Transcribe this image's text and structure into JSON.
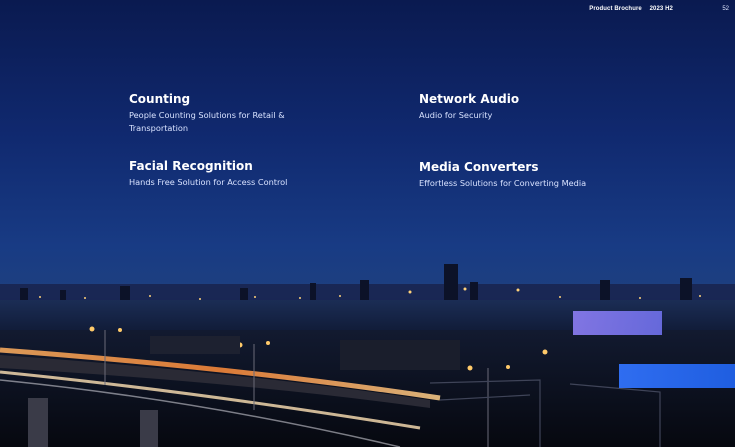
{
  "header": {
    "doc_title": "Product Brochure",
    "edition": "2023 H2",
    "page_number": "52"
  },
  "items": [
    {
      "title": "Counting",
      "description": "People Counting Solutions for Retail & Transportation"
    },
    {
      "title": "Network Audio",
      "description": "Audio for Security"
    },
    {
      "title": "Facial Recognition",
      "description": "Hands Free Solution for Access Control"
    },
    {
      "title": "Media Converters",
      "description": "Effortless Solutions for Converting Media"
    }
  ],
  "colors": {
    "accent_purple": "#7b76ee",
    "accent_blue": "#2766ea",
    "sky_top": "#0b1c55",
    "text_light": "#d8e2ff"
  }
}
